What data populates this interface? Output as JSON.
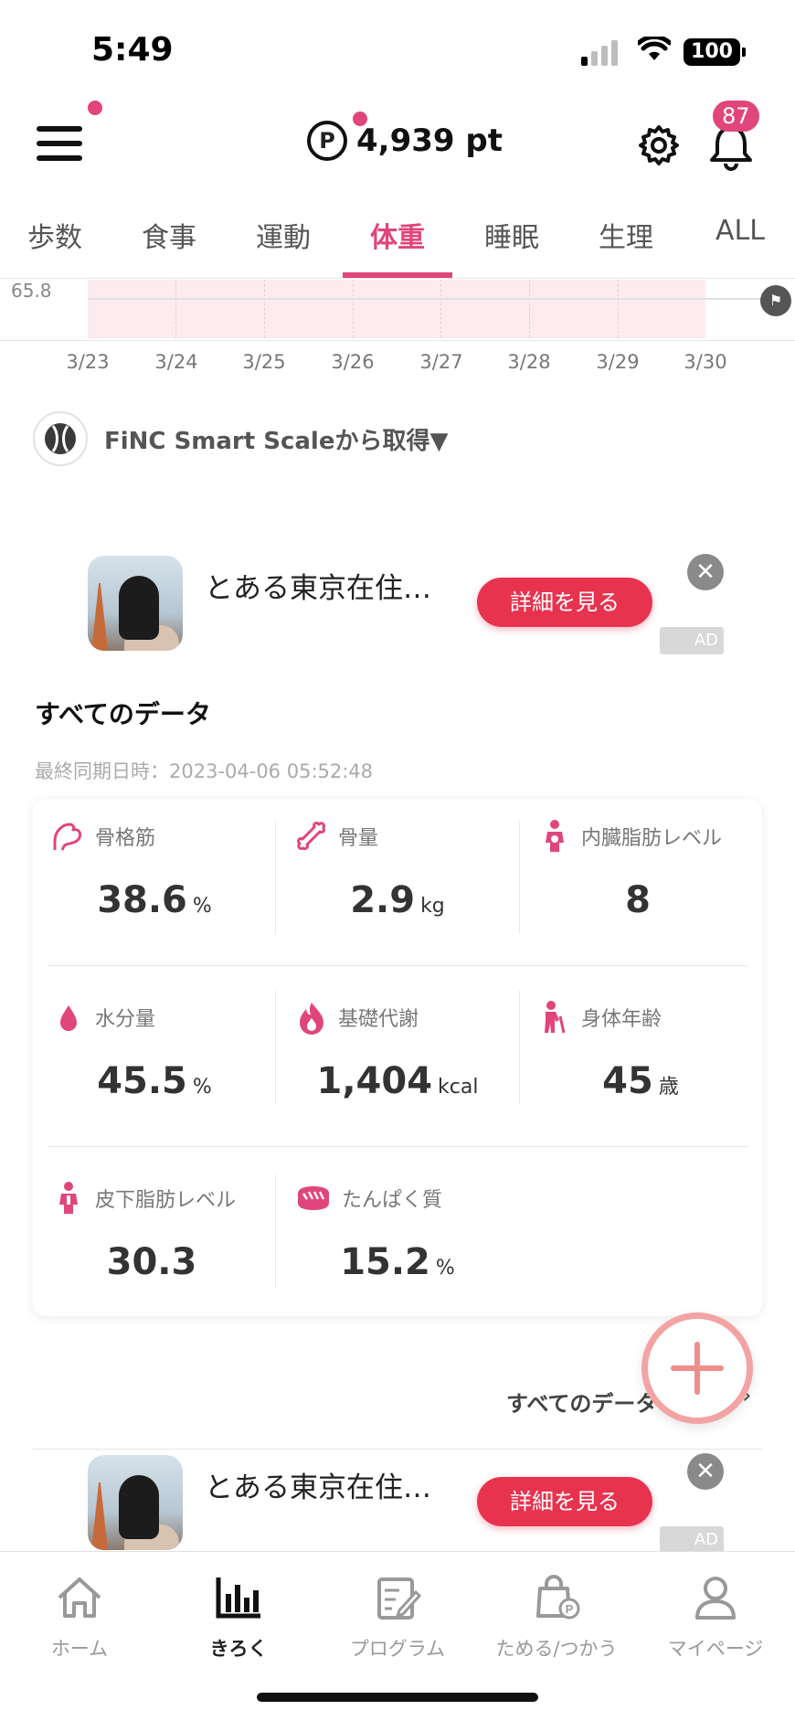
{
  "status_bar": {
    "time": "5:49",
    "battery": "100"
  },
  "header": {
    "points": "4,939 pt",
    "notification_count": "87",
    "points_icon_letter": "P"
  },
  "tabs": [
    {
      "label": "歩数"
    },
    {
      "label": "食事"
    },
    {
      "label": "運動"
    },
    {
      "label": "体重",
      "active": true
    },
    {
      "label": "睡眠"
    },
    {
      "label": "生理"
    },
    {
      "label": "ALL"
    }
  ],
  "chart": {
    "y_label": "65.8",
    "dates": [
      "3/23",
      "3/24",
      "3/25",
      "3/26",
      "3/27",
      "3/28",
      "3/29",
      "3/30"
    ]
  },
  "source": {
    "text": "FiNC Smart Scaleから取得▼"
  },
  "ad": {
    "title": "とある東京在住…",
    "button": "詳細を見る",
    "badge": "AD",
    "close": "✕"
  },
  "all_data": {
    "title": "すべてのデータ",
    "last_sync": "最終同期日時：2023-04-06 05:52:48",
    "metrics": [
      {
        "label": "骨格筋",
        "value": "38.6",
        "unit": "%",
        "icon": "muscle-icon"
      },
      {
        "label": "骨量",
        "value": "2.9",
        "unit": "kg",
        "icon": "bone-icon"
      },
      {
        "label": "内臓脂肪レベル",
        "value": "8",
        "unit": "",
        "icon": "visceral-fat-icon"
      },
      {
        "label": "水分量",
        "value": "45.5",
        "unit": "%",
        "icon": "water-drop-icon"
      },
      {
        "label": "基礎代謝",
        "value": "1,404",
        "unit": "kcal",
        "icon": "flame-icon"
      },
      {
        "label": "身体年齢",
        "value": "45",
        "unit": "歳",
        "icon": "body-age-icon"
      },
      {
        "label": "皮下脂肪レベル",
        "value": "30.3",
        "unit": "",
        "icon": "subcutaneous-fat-icon"
      },
      {
        "label": "たんぱく質",
        "value": "15.2",
        "unit": "%",
        "icon": "protein-icon"
      }
    ],
    "link": "すべてのデータ",
    "link_chevron": "›"
  },
  "bottom_nav": [
    {
      "label": "ホーム",
      "icon": "home-icon"
    },
    {
      "label": "きろく",
      "icon": "bar-chart-icon",
      "active": true
    },
    {
      "label": "プログラム",
      "icon": "program-icon"
    },
    {
      "label": "ためる/つかう",
      "icon": "shopping-bag-icon"
    },
    {
      "label": "マイページ",
      "icon": "person-icon"
    }
  ],
  "colors": {
    "accent": "#e0457b",
    "ad_button": "#e8334f",
    "fab_ring": "#f3a3a3"
  }
}
